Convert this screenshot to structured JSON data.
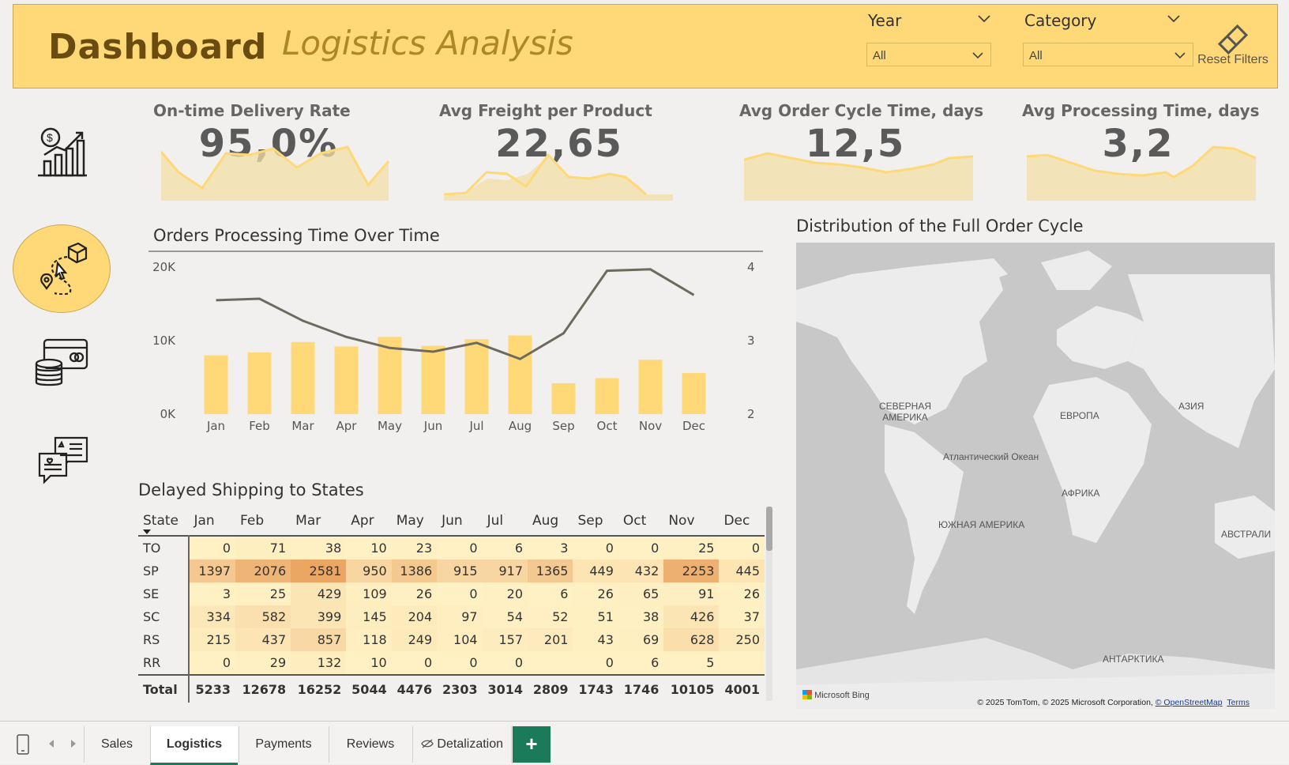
{
  "header": {
    "title": "Dashboard",
    "subtitle": "Logistics Analysis",
    "year_label": "Year",
    "year_value": "All",
    "category_label": "Category",
    "category_value": "All",
    "reset_label": "Reset Filters"
  },
  "kpis": [
    {
      "title": "On-time Delivery Rate",
      "value": "95,0%"
    },
    {
      "title": "Avg Freight per Product",
      "value": "22,65"
    },
    {
      "title": "Avg Order Cycle Time, days",
      "value": "12,5"
    },
    {
      "title": "Avg Processing Time, days",
      "value": "3,2"
    }
  ],
  "sidebar": {
    "icons": [
      "sales-chart-icon",
      "logistics-route-icon",
      "payments-card-coins-icon",
      "reviews-chat-icon"
    ],
    "active_color": "#ffd977"
  },
  "chart_titles": {
    "line_bar": "Orders Processing Time Over Time",
    "map": "Distribution of the Full Order Cycle",
    "table": "Delayed Shipping to States"
  },
  "chart_data": {
    "type": "bar",
    "categories": [
      "Jan",
      "Feb",
      "Mar",
      "Apr",
      "May",
      "Jun",
      "Jul",
      "Aug",
      "Sep",
      "Oct",
      "Nov",
      "Dec"
    ],
    "series": [
      {
        "type": "bar",
        "axis": "left",
        "values": [
          8000,
          8400,
          9800,
          9200,
          10500,
          9300,
          10200,
          10700,
          4200,
          4900,
          7400,
          5600
        ],
        "color": "#ffd977"
      },
      {
        "type": "line",
        "axis": "right",
        "values": [
          3.55,
          3.57,
          3.27,
          3.05,
          2.9,
          2.85,
          2.97,
          2.75,
          3.1,
          3.95,
          3.97,
          3.62
        ],
        "color": "#6e6a5e"
      }
    ],
    "left_ticks": [
      "20K",
      "10K",
      "0K"
    ],
    "right_ticks": [
      "4",
      "3",
      "2"
    ],
    "ylim": [
      0,
      20000
    ],
    "y2lim": [
      2,
      4
    ]
  },
  "map": {
    "labels": [
      {
        "name": "north-america",
        "text": "СЕВЕРНАЯ\nАМЕРИКА"
      },
      {
        "name": "europe",
        "text": "ЕВРОПА"
      },
      {
        "name": "asia",
        "text": "АЗИЯ"
      },
      {
        "name": "atlantic",
        "text": "Атлантический Океан"
      },
      {
        "name": "africa",
        "text": "АФРИКА"
      },
      {
        "name": "south-america",
        "text": "ЮЖНАЯ АМЕРИКА"
      },
      {
        "name": "australia",
        "text": "АВСТРАЛИ"
      },
      {
        "name": "antarctica",
        "text": "АНТАРКТИКА"
      }
    ],
    "brand": "Microsoft Bing",
    "copyright": "© 2025 TomTom, © 2025 Microsoft Corporation,",
    "osm": "© OpenStreetMap",
    "terms": "Terms"
  },
  "table": {
    "state_header": "State",
    "months": [
      "Jan",
      "Feb",
      "Mar",
      "Apr",
      "May",
      "Jun",
      "Jul",
      "Aug",
      "Sep",
      "Oct",
      "Nov",
      "Dec"
    ],
    "rows": [
      {
        "state": "TO",
        "values": [
          "0",
          "71",
          "38",
          "10",
          "23",
          "0",
          "6",
          "3",
          "0",
          "0",
          "25",
          "0"
        ]
      },
      {
        "state": "SP",
        "values": [
          "1397",
          "2076",
          "2581",
          "950",
          "1386",
          "915",
          "917",
          "1365",
          "449",
          "432",
          "2253",
          "445"
        ]
      },
      {
        "state": "SE",
        "values": [
          "3",
          "25",
          "429",
          "109",
          "26",
          "0",
          "20",
          "6",
          "26",
          "65",
          "91",
          "26"
        ]
      },
      {
        "state": "SC",
        "values": [
          "334",
          "582",
          "399",
          "145",
          "204",
          "97",
          "54",
          "52",
          "51",
          "38",
          "426",
          "37"
        ]
      },
      {
        "state": "RS",
        "values": [
          "215",
          "437",
          "857",
          "118",
          "249",
          "104",
          "157",
          "201",
          "43",
          "69",
          "628",
          "250"
        ]
      },
      {
        "state": "RR",
        "values": [
          "0",
          "29",
          "132",
          "10",
          "0",
          "0",
          "0",
          "",
          "0",
          "6",
          "5",
          ""
        ]
      }
    ],
    "total_label": "Total",
    "totals": [
      "5233",
      "12678",
      "16252",
      "5044",
      "4476",
      "2303",
      "3014",
      "2809",
      "1743",
      "1746",
      "10105",
      "4001"
    ]
  },
  "tabs": [
    {
      "label": "Sales",
      "active": false
    },
    {
      "label": "Logistics",
      "active": true
    },
    {
      "label": "Payments",
      "active": false
    },
    {
      "label": "Reviews",
      "active": false
    },
    {
      "label": "Detalization",
      "active": false
    }
  ],
  "add_tab_label": "+"
}
